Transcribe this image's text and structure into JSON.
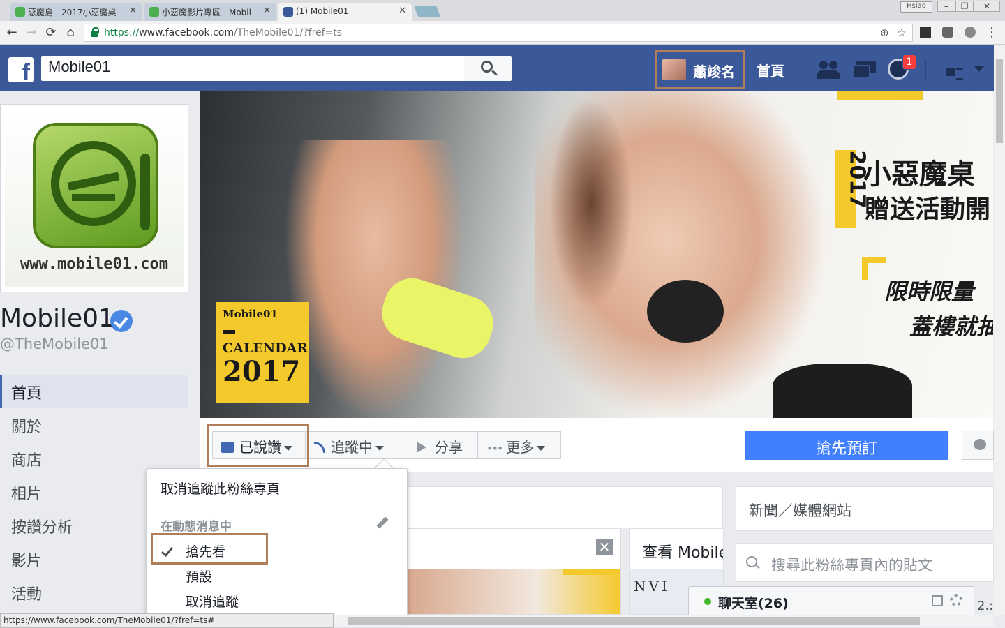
{
  "browser": {
    "tabs": [
      {
        "title": "惡魔島 - 2017小惡魔桌",
        "favicon_color": "#4caf50"
      },
      {
        "title": "小惡魔影片專區 - Mobil",
        "favicon_color": "#4caf50"
      },
      {
        "title": "(1) Mobile01",
        "favicon_color": "#3b5998"
      }
    ],
    "profile_name": "Hsiao",
    "url_scheme": "https://",
    "url_host": "www.facebook.com",
    "url_path": "/TheMobile01/?fref=ts",
    "nav": {
      "back": "←",
      "forward": "→",
      "reload": "⟳",
      "home": "⌂"
    },
    "window_controls": {
      "minimize": "–",
      "maximize": "❐",
      "close": "✕"
    }
  },
  "fb_header": {
    "logo": "f",
    "search_value": "Mobile01",
    "user_name": "蕭竣名",
    "home_label": "首頁",
    "notification_count": "1"
  },
  "page": {
    "logo_url_text": "www.mobile01.com",
    "name": "Mobile01",
    "handle": "@TheMobile01",
    "nav_items": [
      "首頁",
      "關於",
      "商店",
      "相片",
      "按讚分析",
      "影片",
      "活動"
    ]
  },
  "cover": {
    "calendar_brand": "Mobile01",
    "calendar_word": "CALENDAR",
    "calendar_year": "2017",
    "promo_year": "2017",
    "promo_line1": "小惡魔桌",
    "promo_line2": "贈送活動開",
    "promo_line3": "限時限量",
    "promo_line4": "蓋樓就抽"
  },
  "actions": {
    "liked": "已說讚",
    "following": "追蹤中",
    "share": "分享",
    "more": "更多",
    "cta": "搶先預訂"
  },
  "dropdown": {
    "unfollow_page": "取消追蹤此粉絲專頁",
    "section_title": "在動態消息中",
    "option_see_first": "搶先看",
    "option_default": "預設",
    "option_unfollow": "取消追蹤"
  },
  "content": {
    "view_title": "查看 Mobile",
    "view_image_text": "NVI",
    "side_category": "新聞／媒體網站",
    "side_search_placeholder": "搜尋此粉絲專頁內的貼文"
  },
  "chat": {
    "label": "聊天室(26)",
    "side_text": "2.:"
  },
  "status_url": "https://www.facebook.com/TheMobile01/?fref=ts#",
  "colors": {
    "fb_blue": "#3b5998",
    "cta_blue": "#4080ff",
    "highlight_box": "#b07f5a",
    "promo_yellow": "#f4c92c"
  }
}
